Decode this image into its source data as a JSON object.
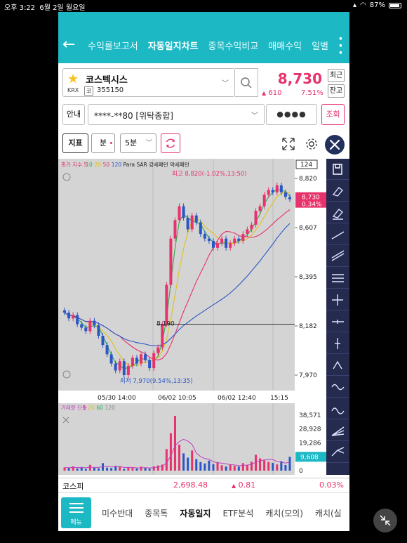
{
  "status_bar": {
    "time": "오후 3:22",
    "date": "6월 2일 월요일",
    "battery": "87%"
  },
  "header": {
    "tabs": [
      {
        "label": "수익률보고서",
        "active": false
      },
      {
        "label": "자동일지차트",
        "active": true
      },
      {
        "label": "종목수익비교",
        "active": false
      },
      {
        "label": "매매수익",
        "active": false
      },
      {
        "label": "일별",
        "active": false
      }
    ]
  },
  "stock": {
    "name": "코스텍시스",
    "exchange": "KRX",
    "code_badge": "코",
    "code": "355150",
    "price": "8,730",
    "change": "610",
    "change_rate": "7.51%",
    "recent_label": "최근",
    "balance_label": "잔고"
  },
  "account": {
    "guide_label": "안내",
    "account_text": "****-**80 [위탁종합]",
    "password_mask": "●●●●",
    "query_label": "조회"
  },
  "toolbar": {
    "indicator_label": "지표",
    "minute_label": "분",
    "period_value": "5분"
  },
  "colors": {
    "accent": "#1cb8c4",
    "up": "#e8326b",
    "down": "#2a56c6",
    "sidebar": "#252a4f"
  },
  "chart_data": {
    "type": "candlestick",
    "price_panel": {
      "legend": [
        {
          "text": "종가 지수 5",
          "color": "#e8326b"
        },
        {
          "text": "10",
          "color": "#2fa84f"
        },
        {
          "text": "20",
          "color": "#e0c21a"
        },
        {
          "text": "50",
          "color": "#e8326b"
        },
        {
          "text": "120",
          "color": "#2a56c6"
        },
        {
          "text": "Para SAR 강세패턴 약세패턴",
          "color": "#222222"
        }
      ],
      "y_ticks": [
        "8,820",
        "8,607",
        "8,395",
        "8,182",
        "7,970"
      ],
      "y_range": [
        7970,
        8820
      ],
      "x_ticks": [
        "05/30 14:00",
        "06/02 10:05",
        "06/02 12:40",
        "15:15"
      ],
      "count_label": "124",
      "high_annotation": "최고 8,820(-1.02%,13:50)",
      "low_annotation": "최저 7,970(9.54%,13:35)",
      "hline_label": "8,190",
      "current_price": "8,730",
      "current_rate": "0.34%",
      "closes": [
        8240,
        8215,
        8230,
        8190,
        8175,
        8160,
        8205,
        8185,
        8140,
        8100,
        8060,
        8020,
        7990,
        8030,
        7970,
        8010,
        8045,
        8020,
        8060,
        8035,
        8000,
        8065,
        8090,
        8190,
        8360,
        8560,
        8640,
        8700,
        8650,
        8600,
        8660,
        8630,
        8580,
        8560,
        8550,
        8520,
        8540,
        8560,
        8520,
        8540,
        8560,
        8550,
        8580,
        8600,
        8620,
        8680,
        8700,
        8750,
        8770,
        8760,
        8790,
        8760,
        8740,
        8730
      ]
    },
    "volume_panel": {
      "legend": [
        {
          "text": "거래량 단순",
          "color": "#c03fc3"
        },
        {
          "text": "5",
          "color": "#e8326b"
        },
        {
          "text": "20",
          "color": "#e0c21a"
        },
        {
          "text": "60",
          "color": "#2fa84f"
        },
        {
          "text": "120",
          "color": "#888888"
        }
      ],
      "y_ticks": [
        "38,571",
        "28,928",
        "19,286",
        "0"
      ],
      "y_range": [
        0,
        40000
      ],
      "current_volume": "9,608",
      "volumes": [
        2200,
        1800,
        3000,
        1500,
        2500,
        1200,
        4000,
        2000,
        1600,
        5200,
        2100,
        1800,
        3300,
        2600,
        1200,
        2300,
        1900,
        1500,
        2800,
        2000,
        1400,
        3000,
        3600,
        4200,
        15000,
        26000,
        38000,
        18000,
        12000,
        9000,
        14000,
        8000,
        6000,
        5000,
        7000,
        4500,
        5600,
        3800,
        2900,
        4200,
        3300,
        2800,
        5200,
        4000,
        6200,
        11000,
        8500,
        7200,
        6100,
        5400,
        4300,
        6600,
        3900,
        9608
      ]
    }
  },
  "market": {
    "name": "코스피",
    "value": "2,698.48",
    "change": "0.81",
    "rate": "0.03%"
  },
  "bottom_nav": {
    "menu_label": "메뉴",
    "items": [
      {
        "label": "미수반대",
        "active": false
      },
      {
        "label": "종목톡",
        "active": false
      },
      {
        "label": "자동일지",
        "active": true
      },
      {
        "label": "ETF분석",
        "active": false
      },
      {
        "label": "캐치(모의)",
        "active": false
      },
      {
        "label": "캐치(실",
        "active": false
      }
    ]
  }
}
